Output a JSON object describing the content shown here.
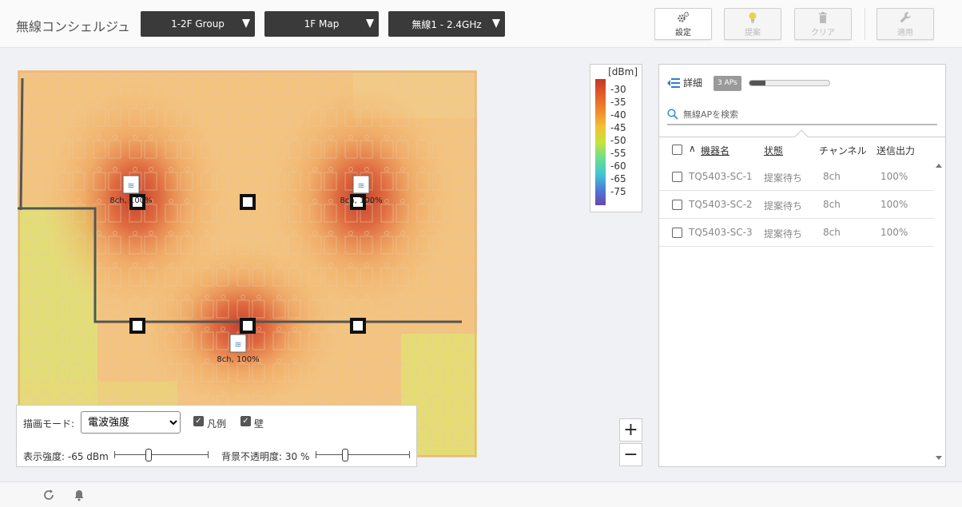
{
  "app": {
    "title": "無線コンシェルジュ"
  },
  "selectors": [
    {
      "value": "1-2F Group"
    },
    {
      "value": "1F Map"
    },
    {
      "value": "無線1 - 2.4GHz"
    }
  ],
  "toolbar": {
    "settings": {
      "label": "設定",
      "icon": "gear-icon"
    },
    "suggest": {
      "label": "提案",
      "icon": "lightbulb-icon"
    },
    "clear": {
      "label": "クリア",
      "icon": "trash-icon"
    },
    "apply": {
      "label": "適用",
      "icon": "wrench-icon"
    }
  },
  "map": {
    "aps": [
      {
        "label": "8ch, 100%"
      },
      {
        "label": "8ch, 100%"
      },
      {
        "label": "8ch, 100%"
      }
    ]
  },
  "legend": {
    "unit": "[dBm]",
    "ticks": [
      "-30",
      "-35",
      "-40",
      "-45",
      "-50",
      "-55",
      "-60",
      "-65",
      "-75"
    ],
    "colors": {
      "strong": "#c0392b",
      "mid": "#c9e23a",
      "weak": "#6a47a8"
    }
  },
  "zoom": {
    "in": "+",
    "out": "−"
  },
  "panel": {
    "detail_label": "詳細",
    "ap_count": "3 APs",
    "progress": 0.2,
    "search_placeholder": "無線APを検索",
    "columns": {
      "name": "機器名",
      "status": "状態",
      "channel": "チャンネル",
      "power": "送信出力"
    },
    "rows": [
      {
        "name": "TQ5403-SC-1",
        "status": "提案待ち",
        "channel": "8ch",
        "power": "100%"
      },
      {
        "name": "TQ5403-SC-2",
        "status": "提案待ち",
        "channel": "8ch",
        "power": "100%"
      },
      {
        "name": "TQ5403-SC-3",
        "status": "提案待ち",
        "channel": "8ch",
        "power": "100%"
      }
    ]
  },
  "controls": {
    "mode_label": "描画モード:",
    "mode_value": "電波強度",
    "legend_label": "凡例",
    "wall_label": "壁",
    "strength_label": "表示強度: -65 dBm",
    "strength_position": 0.35,
    "opacity_label": "背景不透明度: 30 %",
    "opacity_position": 0.3
  }
}
